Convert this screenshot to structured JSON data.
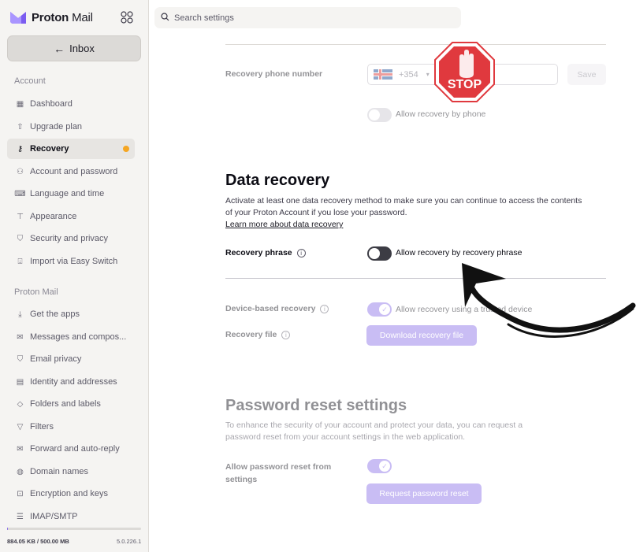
{
  "brand": {
    "name_bold": "Proton",
    "name_light": " Mail"
  },
  "inbox_button": "Inbox",
  "sidebar": {
    "account_section": "Account",
    "account_items": [
      {
        "label": "Dashboard"
      },
      {
        "label": "Upgrade plan"
      },
      {
        "label": "Recovery"
      },
      {
        "label": "Account and password"
      },
      {
        "label": "Language and time"
      },
      {
        "label": "Appearance"
      },
      {
        "label": "Security and privacy"
      },
      {
        "label": "Import via Easy Switch"
      }
    ],
    "mail_section": "Proton Mail",
    "mail_items": [
      {
        "label": "Get the apps"
      },
      {
        "label": "Messages and compos..."
      },
      {
        "label": "Email privacy"
      },
      {
        "label": "Identity and addresses"
      },
      {
        "label": "Folders and labels"
      },
      {
        "label": "Filters"
      },
      {
        "label": "Forward and auto-reply"
      },
      {
        "label": "Domain names"
      },
      {
        "label": "Encryption and keys"
      },
      {
        "label": "IMAP/SMTP"
      }
    ],
    "storage_used": "884.05 KB / 500.00 MB",
    "storage_fraction": 0.0017,
    "version": "5.0.226.1"
  },
  "search": {
    "placeholder": "Search settings"
  },
  "recovery_phone": {
    "label": "Recovery phone number",
    "country_code": "+354",
    "save_label": "Save",
    "toggle_label": "Allow recovery by phone"
  },
  "data_recovery": {
    "title": "Data recovery",
    "description": "Activate at least one data recovery method to make sure you can continue to access the contents of your Proton Account if you lose your password.",
    "learn_more": "Learn more about data recovery",
    "phrase_label": "Recovery phrase",
    "phrase_toggle_label": "Allow recovery by recovery phrase",
    "device_label": "Device-based recovery",
    "device_toggle_label": "Allow recovery using a trusted device",
    "file_label": "Recovery file",
    "file_button": "Download recovery file"
  },
  "password_reset": {
    "title": "Password reset settings",
    "description": "To enhance the security of your account and protect your data, you can request a password reset from your account settings in the web application.",
    "allow_label": "Allow password reset from settings",
    "request_button": "Request password reset"
  },
  "overlay": {
    "stop_sign_text": "STOP"
  },
  "colors": {
    "accent": "#8a6ee8",
    "notification_dot": "#f5a623",
    "stop_red": "#e0393e"
  }
}
